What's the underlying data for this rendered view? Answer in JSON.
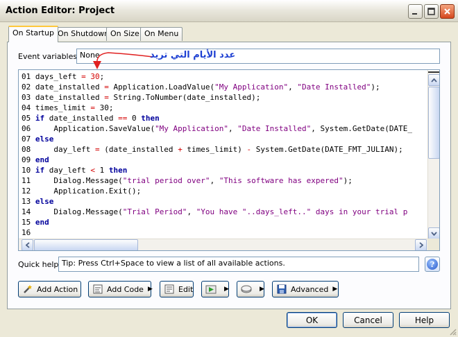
{
  "window": {
    "title": "Action Editor: Project"
  },
  "tabs": [
    {
      "label": "On Startup",
      "active": true
    },
    {
      "label": "On Shutdown",
      "active": false
    },
    {
      "label": "On Size",
      "active": false
    },
    {
      "label": "On Menu",
      "active": false
    }
  ],
  "event_variables": {
    "label": "Event variables:",
    "value": "None"
  },
  "annotation": {
    "text": "عدد الأيام التي تريد",
    "color": "#1D3FD2"
  },
  "code_lines": [
    {
      "n": "01",
      "parts": [
        [
          "t",
          "days_left "
        ],
        [
          "op",
          "="
        ],
        [
          "t",
          " "
        ],
        [
          "op",
          "30"
        ],
        [
          "t",
          ";"
        ]
      ]
    },
    {
      "n": "02",
      "parts": [
        [
          "t",
          "date_installed "
        ],
        [
          "op",
          "="
        ],
        [
          "t",
          " Application.LoadValue("
        ],
        [
          "str",
          "\"My Application\""
        ],
        [
          "t",
          ", "
        ],
        [
          "str",
          "\"Date Installed\""
        ],
        [
          "t",
          ");"
        ]
      ]
    },
    {
      "n": "03",
      "parts": [
        [
          "t",
          "date_installed "
        ],
        [
          "op",
          "="
        ],
        [
          "t",
          " String.ToNumber(date_installed);"
        ]
      ]
    },
    {
      "n": "04",
      "parts": [
        [
          "t",
          "times_limit "
        ],
        [
          "op",
          "="
        ],
        [
          "t",
          " 30;"
        ]
      ]
    },
    {
      "n": "05",
      "parts": [
        [
          "kw",
          "if"
        ],
        [
          "t",
          " date_installed "
        ],
        [
          "op",
          "=="
        ],
        [
          "t",
          " 0 "
        ],
        [
          "kw",
          "then"
        ]
      ]
    },
    {
      "n": "06",
      "parts": [
        [
          "t",
          "    Application.SaveValue("
        ],
        [
          "str",
          "\"My Application\""
        ],
        [
          "t",
          ", "
        ],
        [
          "str",
          "\"Date Installed\""
        ],
        [
          "t",
          ", System.GetDate(DATE_"
        ]
      ]
    },
    {
      "n": "07",
      "parts": [
        [
          "kw",
          "else"
        ]
      ]
    },
    {
      "n": "08",
      "parts": [
        [
          "t",
          "    day_left "
        ],
        [
          "op",
          "="
        ],
        [
          "t",
          " (date_installed "
        ],
        [
          "op",
          "+"
        ],
        [
          "t",
          " times_limit) "
        ],
        [
          "op",
          "-"
        ],
        [
          "t",
          " System.GetDate(DATE_FMT_JULIAN);"
        ]
      ]
    },
    {
      "n": "09",
      "parts": [
        [
          "kw",
          "end"
        ]
      ]
    },
    {
      "n": "10",
      "parts": [
        [
          "kw",
          "if"
        ],
        [
          "t",
          " day_left "
        ],
        [
          "op",
          "<"
        ],
        [
          "t",
          " 1 "
        ],
        [
          "kw",
          "then"
        ]
      ]
    },
    {
      "n": "11",
      "parts": [
        [
          "t",
          "    Dialog.Message("
        ],
        [
          "str",
          "\"trial period over\""
        ],
        [
          "t",
          ", "
        ],
        [
          "str",
          "\"This software has expered\""
        ],
        [
          "t",
          ");"
        ]
      ]
    },
    {
      "n": "12",
      "parts": [
        [
          "t",
          "    Application.Exit();"
        ]
      ]
    },
    {
      "n": "13",
      "parts": [
        [
          "kw",
          "else"
        ]
      ]
    },
    {
      "n": "14",
      "parts": [
        [
          "t",
          "    Dialog.Message("
        ],
        [
          "str",
          "\"Trial Period\""
        ],
        [
          "t",
          ", "
        ],
        [
          "str",
          "\"You have \"..days_left..\" days in your trial p"
        ]
      ]
    },
    {
      "n": "15",
      "parts": [
        [
          "kw",
          "end"
        ]
      ]
    },
    {
      "n": "16",
      "parts": []
    }
  ],
  "quick_help": {
    "label": "Quick help:",
    "value": "Tip: Press Ctrl+Space to view a list of all available actions."
  },
  "action_buttons": {
    "add_action": "Add Action",
    "add_code": "Add Code",
    "edit": "Edit",
    "advanced": "Advanced"
  },
  "dialog_buttons": {
    "ok": "OK",
    "cancel": "Cancel",
    "help": "Help"
  },
  "colors": {
    "keyword": "#00009C",
    "string": "#800080",
    "operator": "#D40000",
    "tab_highlight": "#FFC83C"
  }
}
